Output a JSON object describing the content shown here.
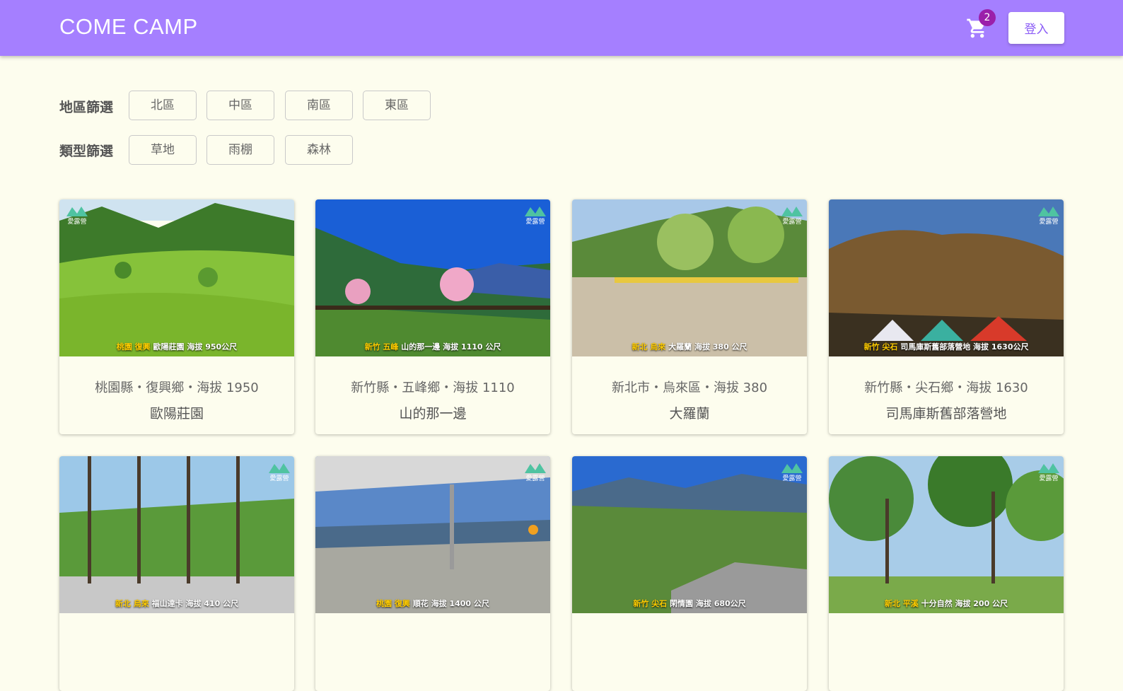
{
  "app": {
    "brand": "COME CAMP"
  },
  "header": {
    "cart_count": "2",
    "login_label": "登入"
  },
  "filters": {
    "region_label": "地區篩選",
    "regions": [
      "北區",
      "中區",
      "南區",
      "東區"
    ],
    "type_label": "類型篩選",
    "types": [
      "草地",
      "雨棚",
      "森林"
    ]
  },
  "logo_text": "愛露營",
  "camps": [
    {
      "location": "桃園縣・復興鄉・海拔 1950",
      "name": "歐陽莊園",
      "cap_region": "桃園 復興",
      "cap_text": "歐陽莊園 海拔 950公尺"
    },
    {
      "location": "新竹縣・五峰鄉・海拔 1110",
      "name": "山的那一邊",
      "cap_region": "新竹 五峰",
      "cap_text": "山的那一邊 海拔 1110 公尺"
    },
    {
      "location": "新北市・烏來區・海拔 380",
      "name": "大羅蘭",
      "cap_region": "新北 烏來",
      "cap_text": "大羅蘭 海拔 380 公尺"
    },
    {
      "location": "新竹縣・尖石鄉・海拔 1630",
      "name": "司馬庫斯舊部落營地",
      "cap_region": "新竹 尖石",
      "cap_text": "司馬庫斯舊部落營地 海拔 1630公尺"
    },
    {
      "location": "",
      "name": "",
      "cap_region": "新北 烏來",
      "cap_text": "福山達卡 海拔 410 公尺"
    },
    {
      "location": "",
      "name": "",
      "cap_region": "桃園 復興",
      "cap_text": "順花 海拔 1400 公尺"
    },
    {
      "location": "",
      "name": "",
      "cap_region": "新竹 尖石",
      "cap_text": "閑情園 海拔 680公尺"
    },
    {
      "location": "",
      "name": "",
      "cap_region": "新北 平溪",
      "cap_text": "十分自然 海拔 200 公尺"
    }
  ]
}
